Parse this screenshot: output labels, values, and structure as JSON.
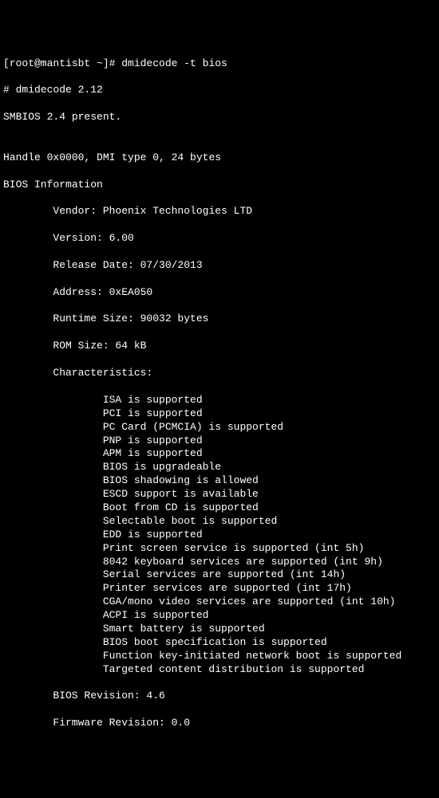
{
  "prompt": "[root@mantisbt ~]# dmidecode -t bios",
  "header1": "# dmidecode 2.12",
  "header2": "SMBIOS 2.4 present.",
  "blank": "",
  "handle": "Handle 0x0000, DMI type 0, 24 bytes",
  "title": "BIOS Information",
  "fields": {
    "vendor": "Vendor: Phoenix Technologies LTD",
    "version": "Version: 6.00",
    "release_date": "Release Date: 07/30/2013",
    "address": "Address: 0xEA050",
    "runtime_size": "Runtime Size: 90032 bytes",
    "rom_size": "ROM Size: 64 kB",
    "characteristics_label": "Characteristics:",
    "bios_revision": "BIOS Revision: 4.6",
    "firmware_revision": "Firmware Revision: 0.0"
  },
  "characteristics": [
    "ISA is supported",
    "PCI is supported",
    "PC Card (PCMCIA) is supported",
    "PNP is supported",
    "APM is supported",
    "BIOS is upgradeable",
    "BIOS shadowing is allowed",
    "ESCD support is available",
    "Boot from CD is supported",
    "Selectable boot is supported",
    "EDD is supported",
    "Print screen service is supported (int 5h)",
    "8042 keyboard services are supported (int 9h)",
    "Serial services are supported (int 14h)",
    "Printer services are supported (int 17h)",
    "CGA/mono video services are supported (int 10h)",
    "ACPI is supported",
    "Smart battery is supported",
    "BIOS boot specification is supported",
    "Function key-initiated network boot is supported",
    "Targeted content distribution is supported"
  ]
}
